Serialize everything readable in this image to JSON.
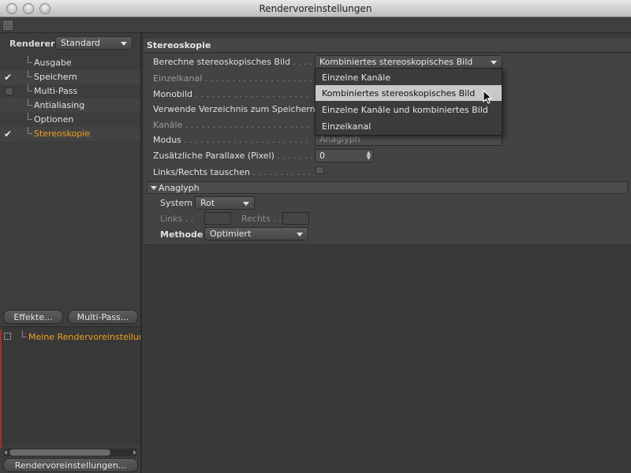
{
  "window": {
    "title": "Rendervoreinstellungen"
  },
  "left": {
    "renderer_label": "Renderer",
    "renderer_value": "Standard",
    "items": [
      {
        "label": "Ausgabe",
        "checked": false,
        "box": false
      },
      {
        "label": "Speichern",
        "checked": true,
        "box": false
      },
      {
        "label": "Multi-Pass",
        "checked": false,
        "box": true
      },
      {
        "label": "Antialiasing",
        "checked": false,
        "box": false
      },
      {
        "label": "Optionen",
        "checked": false,
        "box": false
      },
      {
        "label": "Stereoskopie",
        "checked": true,
        "box": false,
        "active": true
      }
    ],
    "effects_button": "Effekte...",
    "multipass_button": "Multi-Pass...",
    "preset_name": "Meine Rendervoreinstellun",
    "bottom_button": "Rendervoreinstellungen...",
    "scroll_fraction": 0.8
  },
  "right": {
    "section_title": "Stereoskopie",
    "rows": {
      "berechne_label": "Berechne stereoskopisches Bild",
      "berechne_value": "Kombiniertes stereoskopisches Bild",
      "einzelkanal_label": "Einzelkanal",
      "monobild_label": "Monobild",
      "verzeichnis_label": "Verwende Verzeichnis zum Speichern",
      "kanaele_label": "Kanäle",
      "modus_label": "Modus",
      "modus_value": "Anaglyph",
      "parallaxe_label": "Zusätzliche Parallaxe (Pixel)",
      "parallaxe_value": "0",
      "tauschen_label": "Links/Rechts tauschen"
    },
    "anaglyph": {
      "title": "Anaglyph",
      "system_label": "System",
      "system_value": "Rot",
      "links_label": "Links",
      "rechts_label": "Rechts",
      "methode_label": "Methode",
      "methode_value": "Optimiert"
    }
  },
  "popup": {
    "options": [
      "Einzelne Kanäle",
      "Kombiniertes stereoskopisches Bild",
      "Einzelne Kanäle und kombiniertes Bild",
      "Einzelkanal"
    ],
    "selected_index": 1
  }
}
